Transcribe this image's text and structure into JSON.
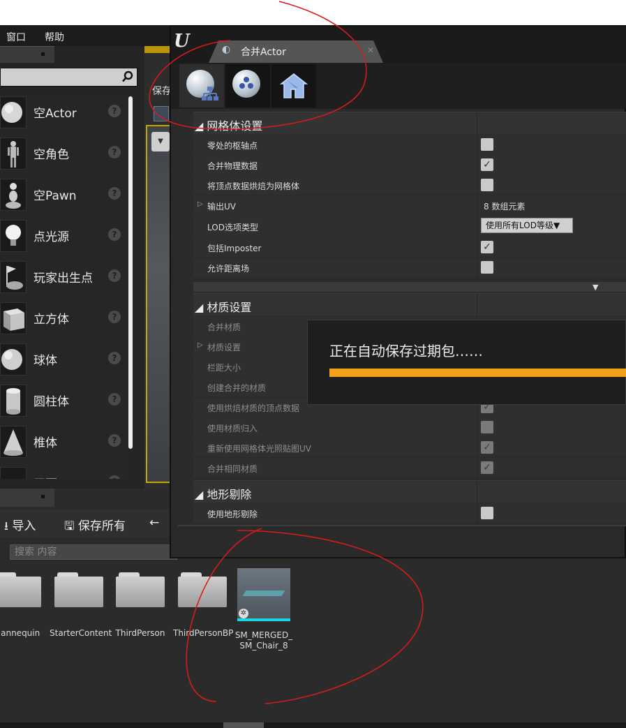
{
  "menubar": {
    "items": [
      "窗口",
      "帮助"
    ]
  },
  "place_actors": {
    "items": [
      {
        "label": "空Actor",
        "icon": "sphere-icon"
      },
      {
        "label": "空角色",
        "icon": "mannequin-icon"
      },
      {
        "label": "空Pawn",
        "icon": "pawn-icon"
      },
      {
        "label": "点光源",
        "icon": "lightbulb-icon"
      },
      {
        "label": "玩家出生点",
        "icon": "player-start-icon"
      },
      {
        "label": "立方体",
        "icon": "cube-icon"
      },
      {
        "label": "球体",
        "icon": "sphere-icon"
      },
      {
        "label": "圆柱体",
        "icon": "cylinder-icon"
      },
      {
        "label": "椎体",
        "icon": "cone-icon"
      },
      {
        "label": "平面",
        "icon": "plane-icon"
      }
    ]
  },
  "viewport": {
    "save_label": "保存"
  },
  "content_browser": {
    "import_label": "导入",
    "save_all_label": "保存所有",
    "search_placeholder": "搜索 内容",
    "folders": [
      "Mannequin",
      "StarterContent",
      "ThirdPerson",
      "ThirdPersonBP"
    ],
    "asset_name_line1": "SM_MERGED_",
    "asset_name_line2": "SM_Chair_8"
  },
  "dialog": {
    "logo": "U",
    "tab_title": "合并Actor",
    "sections": {
      "mesh": {
        "title": "网格体设置",
        "rows": [
          {
            "name": "零处的枢轴点",
            "checked": false
          },
          {
            "name": "合并物理数据",
            "checked": true
          },
          {
            "name": "将顶点数据烘焙为网格体",
            "checked": false
          },
          {
            "name": "输出UV",
            "value": "8 数组元素"
          },
          {
            "name": "LOD选项类型",
            "value": "使用所有LOD等级"
          },
          {
            "name": "包括Imposter",
            "checked": true
          },
          {
            "name": "允许距离场",
            "checked": false
          }
        ]
      },
      "material": {
        "title": "材质设置",
        "rows": [
          {
            "name": "合并材质"
          },
          {
            "name": "材质设置"
          },
          {
            "name": "栏距大小"
          },
          {
            "name": "创建合并的材质"
          },
          {
            "name": "使用烘焙材质的顶点数据",
            "checked": true
          },
          {
            "name": "使用材质归入",
            "checked": false
          },
          {
            "name": "重新使用网格体光照贴图UV",
            "checked": true
          },
          {
            "name": "合并相同材质",
            "checked": true
          }
        ]
      },
      "landscape": {
        "title": "地形剔除",
        "rows": [
          {
            "name": "使用地形剔除",
            "checked": false
          }
        ]
      }
    }
  },
  "toast": {
    "text": "正在自动保存过期包……"
  },
  "colors": {
    "progress": "#f0a21a",
    "asset_accent": "#19d6e3",
    "highlight_border": "#c8a600"
  }
}
